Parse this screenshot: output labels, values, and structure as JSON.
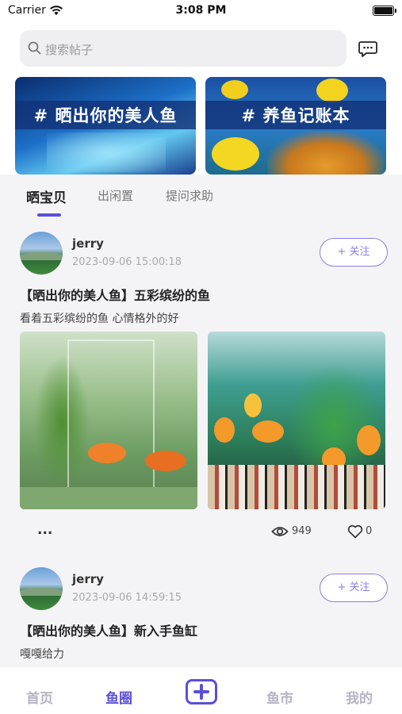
{
  "status_bar": {
    "carrier": "Carrier",
    "time": "3:08 PM"
  },
  "search": {
    "placeholder": "搜索帖子"
  },
  "banners": [
    {
      "title": "# 晒出你的美人鱼"
    },
    {
      "title": "# 养鱼记账本"
    }
  ],
  "tabs": [
    {
      "label": "晒宝贝",
      "active": true
    },
    {
      "label": "出闲置",
      "active": false
    },
    {
      "label": "提问求助",
      "active": false
    }
  ],
  "posts": [
    {
      "username": "jerry",
      "time": "2023-09-06 15:00:18",
      "follow_label": "+ 关注",
      "title": "【晒出你的美人鱼】五彩缤纷的鱼",
      "body": "看着五彩缤纷的鱼 心情格外的好",
      "more": "...",
      "views": "949",
      "likes": "0"
    },
    {
      "username": "jerry",
      "time": "2023-09-06 14:59:15",
      "follow_label": "+ 关注",
      "title": "【晒出你的美人鱼】新入手鱼缸",
      "body": "嘎嘎给力"
    }
  ],
  "tab_bar": {
    "items": [
      {
        "label": "首页",
        "active": false
      },
      {
        "label": "鱼圈",
        "active": true
      },
      {
        "label": "鱼市",
        "active": false
      },
      {
        "label": "我的",
        "active": false
      }
    ]
  },
  "colors": {
    "accent": "#5b4fd8",
    "follow_border": "#8a80e0",
    "inactive_nav": "#b4b4c4"
  },
  "icons": [
    "wifi-icon",
    "battery-icon",
    "search-icon",
    "message-icon",
    "eye-icon",
    "heart-icon",
    "add-post-icon"
  ]
}
